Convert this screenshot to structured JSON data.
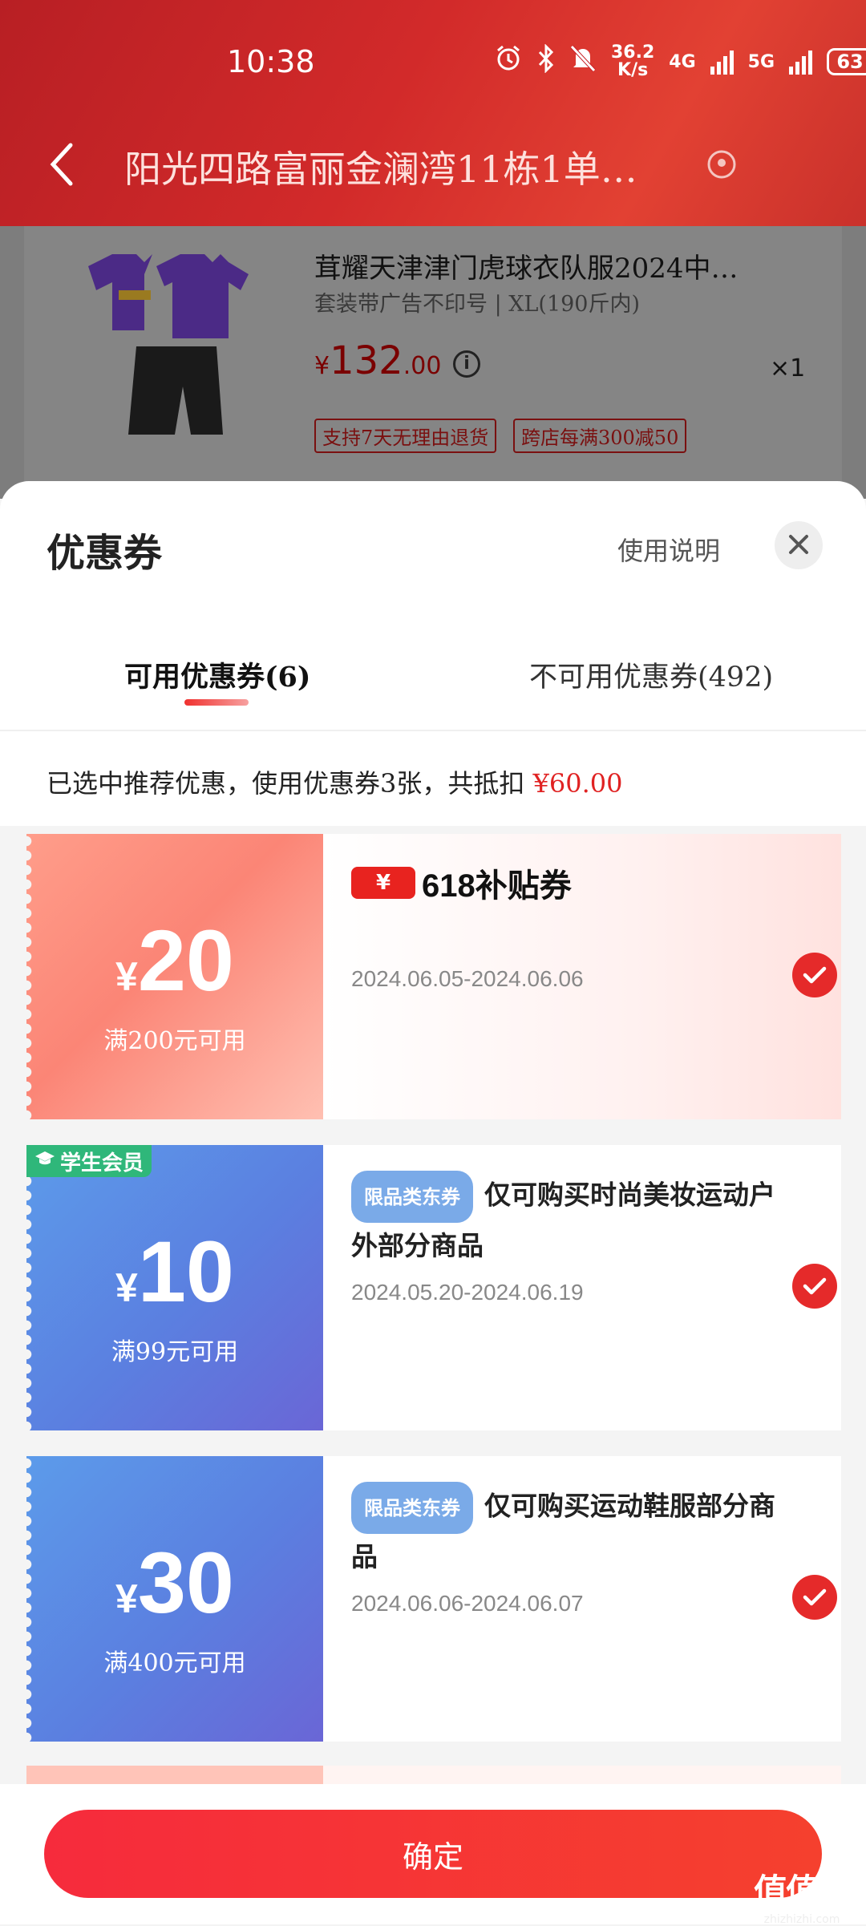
{
  "status_bar": {
    "time": "10:38",
    "speed_top": "36.2",
    "speed_bottom": "K/s",
    "net1": "4G",
    "net2": "5G",
    "battery": "63"
  },
  "header": {
    "address": "阳光四路富丽金澜湾11栋1单…"
  },
  "product": {
    "title": "茸耀天津津门虎球衣队服2024中…",
    "spec": "套装带广告不印号 | XL(190斤内)",
    "price_symbol": "¥",
    "price_int": "132",
    "price_dec": ".00",
    "quantity": "×1",
    "tags": [
      "支持7天无理由退货",
      "跨店每满300减50"
    ]
  },
  "sheet": {
    "title": "优惠券",
    "help_label": "使用说明",
    "tabs": [
      {
        "label": "可用优惠券(6)",
        "active": true
      },
      {
        "label": "不可用优惠券(492)",
        "active": false
      }
    ],
    "summary_text": "已选中推荐优惠，使用优惠券3张，共抵扣",
    "summary_amount": "¥60.00"
  },
  "coupons": [
    {
      "currency": "¥",
      "amount": "20",
      "condition": "满200元可用",
      "badge": "¥",
      "name": "618补贴券",
      "date": "2024.06.05-2024.06.06",
      "selected": true
    },
    {
      "currency": "¥",
      "amount": "10",
      "condition": "满99元可用",
      "member_badge": "学生会员",
      "tag": "限品类东券",
      "desc": "仅可购买时尚美妆运动户外部分商品",
      "date": "2024.05.20-2024.06.19",
      "selected": true
    },
    {
      "currency": "¥",
      "amount": "30",
      "condition": "满400元可用",
      "tag": "限品类东券",
      "desc": "仅可购买运动鞋服部分商品",
      "date": "2024.06.06-2024.06.07",
      "selected": true
    }
  ],
  "footer": {
    "confirm_label": "确定"
  },
  "watermark": {
    "main": "值值值",
    "sub": "zhizhizhi.com"
  },
  "colors": {
    "accent": "#e52a2a",
    "header": "#c9252a",
    "blue_coupon": "#5b7fe0",
    "red_coupon": "#fb8576"
  }
}
